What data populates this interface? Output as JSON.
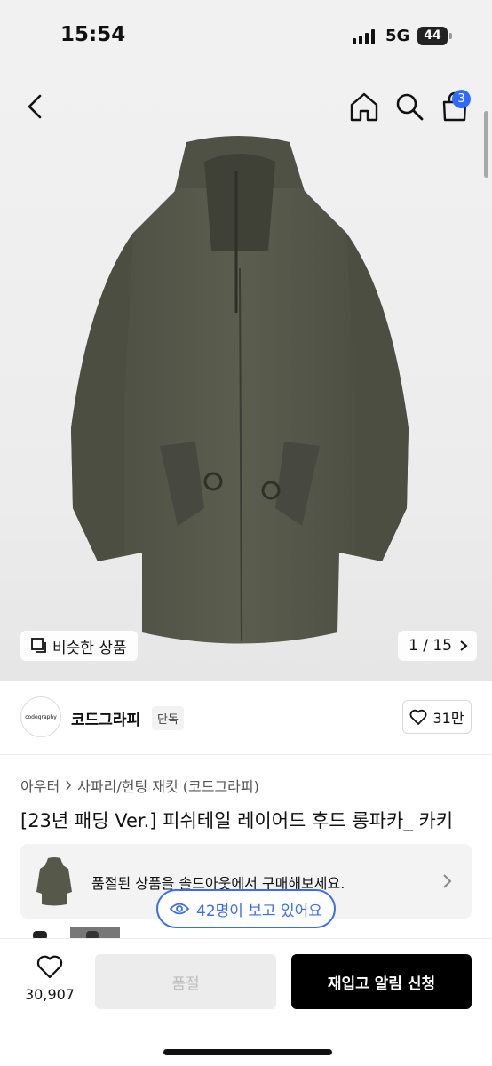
{
  "status_bar": {
    "time": "15:54",
    "network": "5G",
    "battery": "44"
  },
  "header": {
    "cart_count": "3"
  },
  "hero": {
    "similar_label": "비슷한 상품",
    "image_counter": "1 / 15"
  },
  "brand": {
    "logo_text": "codegraphy",
    "name": "코드그라피",
    "tag": "단독",
    "like_count": "31만"
  },
  "breadcrumb": {
    "level1": "아우터",
    "level2": "사파리/헌팅 재킷 (코드그라피)"
  },
  "product": {
    "title": "[23년 패딩 Ver.] 피쉬테일 레이어드 후드 롱파카_ 카키"
  },
  "soldout_banner": {
    "text": "품절된 상품을 솔드아웃에서 구매해보세요."
  },
  "viewers": {
    "text": "42명이 보고 있어요"
  },
  "bottom_bar": {
    "wish_count": "30,907",
    "soldout_label": "품절",
    "restock_label": "재입고 알림 신청"
  },
  "colors": {
    "accent_blue": "#3a6df0",
    "badge_blue": "#2f6bff",
    "coat_khaki": "#56584a"
  }
}
